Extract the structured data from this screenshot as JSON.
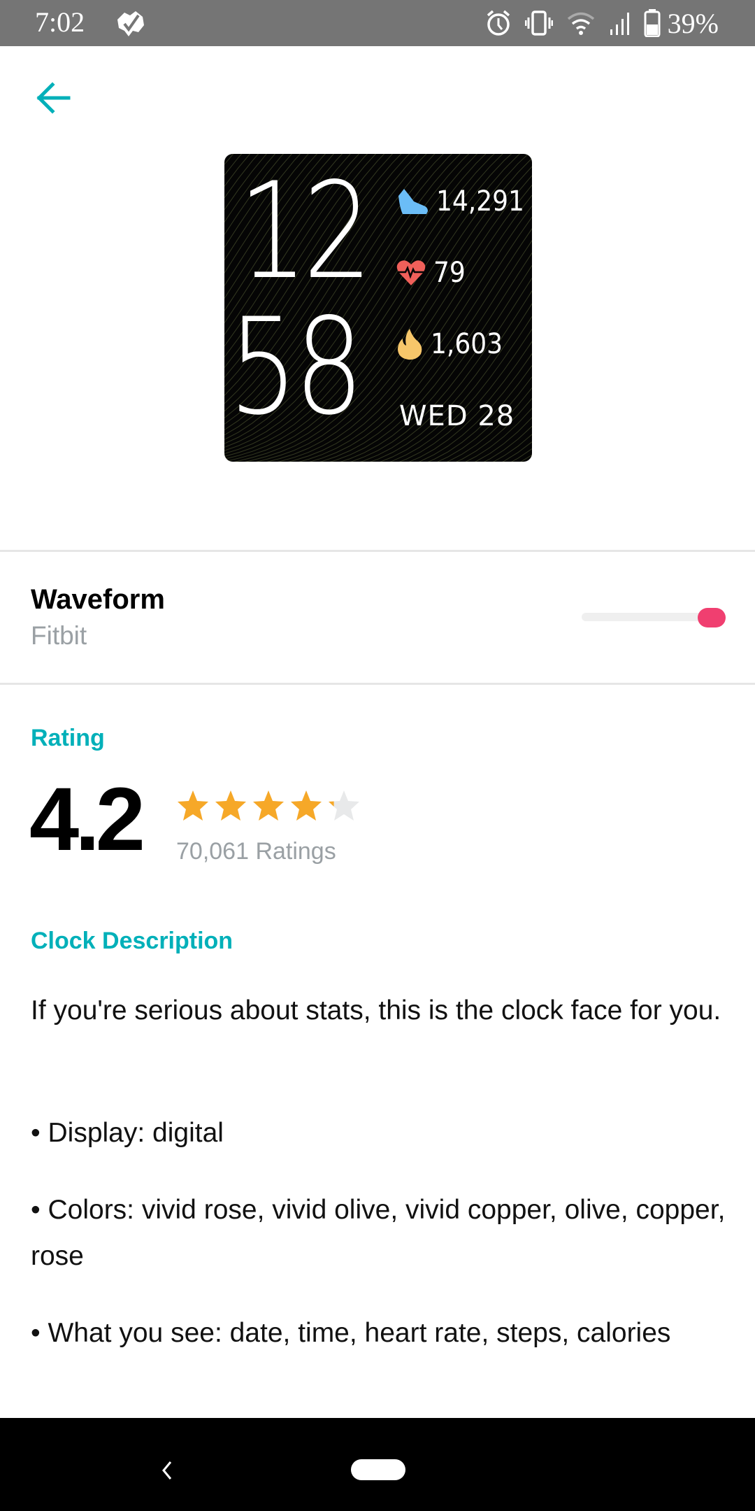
{
  "status_bar": {
    "time": "7:02",
    "battery_percent": "39%",
    "icons": [
      "app-notification-icon",
      "alarm-icon",
      "vibrate-icon",
      "wifi-icon",
      "signal-icon",
      "battery-icon"
    ]
  },
  "header": {
    "back_icon": "arrow-left-icon"
  },
  "watch_face": {
    "hour": "12",
    "minute": "58",
    "steps": "14,291",
    "heart_rate": "79",
    "calories": "1,603",
    "date": "WED 28",
    "colors": {
      "steps": "#6bbdf7",
      "heart": "#f0605a",
      "calories": "#f7c66a"
    }
  },
  "clock_info": {
    "name": "Waveform",
    "developer": "Fitbit",
    "toggle_on": true
  },
  "rating": {
    "label": "Rating",
    "value": "4.2",
    "stars_filled": 4.2,
    "stars_total": 5,
    "count_text": "70,061 Ratings"
  },
  "description": {
    "label": "Clock Description",
    "paragraphs": [
      "If you're serious about stats, this is the clock face for you.",
      "• Display: digital",
      "• Colors: vivid rose, vivid olive, vivid copper, olive, copper, rose",
      "• What you see: date, time, heart rate, steps, calories"
    ]
  },
  "colors": {
    "accent": "#00b0b9",
    "toggle": "#f03f70",
    "star": "#f6a828",
    "star_empty": "#e8e9ea",
    "secondary_text": "#9aa0a4"
  },
  "nav_bar": {
    "back_label": "back",
    "home_label": "home"
  }
}
